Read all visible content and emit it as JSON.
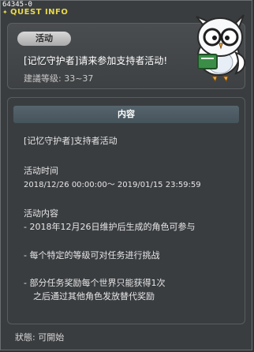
{
  "window": {
    "id_label": "64345-0",
    "title": "QUEST INFO"
  },
  "quest": {
    "badge": "活动",
    "name": "[记忆守护者]请来参加支持者活动!",
    "level": "建議等级: 33~37"
  },
  "content": {
    "header": "内容",
    "lines": [
      "[记忆守护者]支持者活动",
      "活动时间",
      "2018/12/26 00:00:00～ 2019/01/15 23:59:59",
      "活动内容",
      "- 2018年12月26日维护后生成的角色可参与",
      "- 每个特定的等级可对任务进行挑战",
      "- 部分任务奖励每个世界只能获得1次",
      "之后通过其他角色发放替代奖励"
    ]
  },
  "status": "狀態: 可開始",
  "icons": {
    "title": "star-icon",
    "npc": "owl-npc-icon"
  },
  "colors": {
    "title": "#e8d84a",
    "background": "#3a3d3f",
    "header": "#4f5d66"
  }
}
